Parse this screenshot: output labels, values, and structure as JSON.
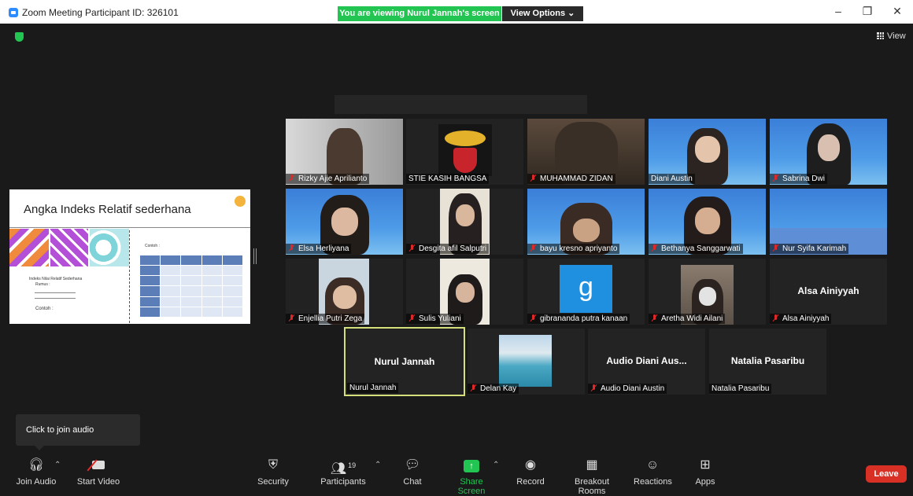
{
  "window": {
    "title": "Zoom Meeting Participant ID: 326101",
    "minimize": "–",
    "restore": "❐",
    "close": "✕"
  },
  "banner": {
    "viewing_text": "You are viewing Nurul Jannah's screen",
    "view_options_label": "View Options ⌄"
  },
  "top_right": {
    "view_label": "View"
  },
  "shared_screen": {
    "slide_title": "Angka Indeks Relatif sederhana",
    "contoh_label": "Contoh :",
    "bullet_text": "Indeks Nilai Relatif Sederhana",
    "rumus_label": "Rumus :",
    "contoh_bottom": "Contoh :"
  },
  "participants": [
    {
      "name": "Rizky Ajie Aprilianto",
      "muted": true
    },
    {
      "name": "STIE KASIH BANGSA",
      "muted": false
    },
    {
      "name": "MUHAMMAD ZIDAN",
      "muted": true
    },
    {
      "name": "Diani Austin",
      "muted": false
    },
    {
      "name": "Sabrina Dwi",
      "muted": true
    },
    {
      "name": "Elsa Herliyana",
      "muted": true
    },
    {
      "name": "Desgita afil Salputri",
      "muted": true
    },
    {
      "name": "bayu kresno apriyanto",
      "muted": true
    },
    {
      "name": "Bethanya Sanggarwati",
      "muted": true
    },
    {
      "name": "Nur Syifa Karimah",
      "muted": true
    },
    {
      "name": "Enjellia Putri Zega",
      "muted": true
    },
    {
      "name": "Sulis Yuliani",
      "muted": true
    },
    {
      "name": "gibrananda putra kanaan",
      "muted": true
    },
    {
      "name": "Aretha Widi Ailani",
      "muted": true
    },
    {
      "name": "Alsa Ainiyyah",
      "muted": true,
      "display_name": "Alsa Ainiyyah"
    },
    {
      "name": "Nurul Jannah",
      "muted": false,
      "display_name": "Nurul Jannah"
    },
    {
      "name": "Delan Kay",
      "muted": true
    },
    {
      "name": "Audio Diani Austin",
      "muted": true,
      "display_name": "Audio Diani Aus..."
    },
    {
      "name": "Natalia Pasaribu",
      "muted": false,
      "display_name": "Natalia Pasaribu"
    }
  ],
  "avatar_letter": "g",
  "audio_popup": {
    "text": "Click to join audio"
  },
  "toolbar": {
    "join_audio": "Join Audio",
    "start_video": "Start Video",
    "security": "Security",
    "participants": "Participants",
    "participants_count": "19",
    "chat": "Chat",
    "share_screen": "Share Screen",
    "record": "Record",
    "breakout_rooms": "Breakout Rooms",
    "reactions": "Reactions",
    "apps": "Apps",
    "leave": "Leave"
  },
  "colors": {
    "banner_green": "#23c552",
    "leave_red": "#d93025",
    "active_speaker_border": "#d6e07b",
    "mute_red": "#e02828"
  }
}
